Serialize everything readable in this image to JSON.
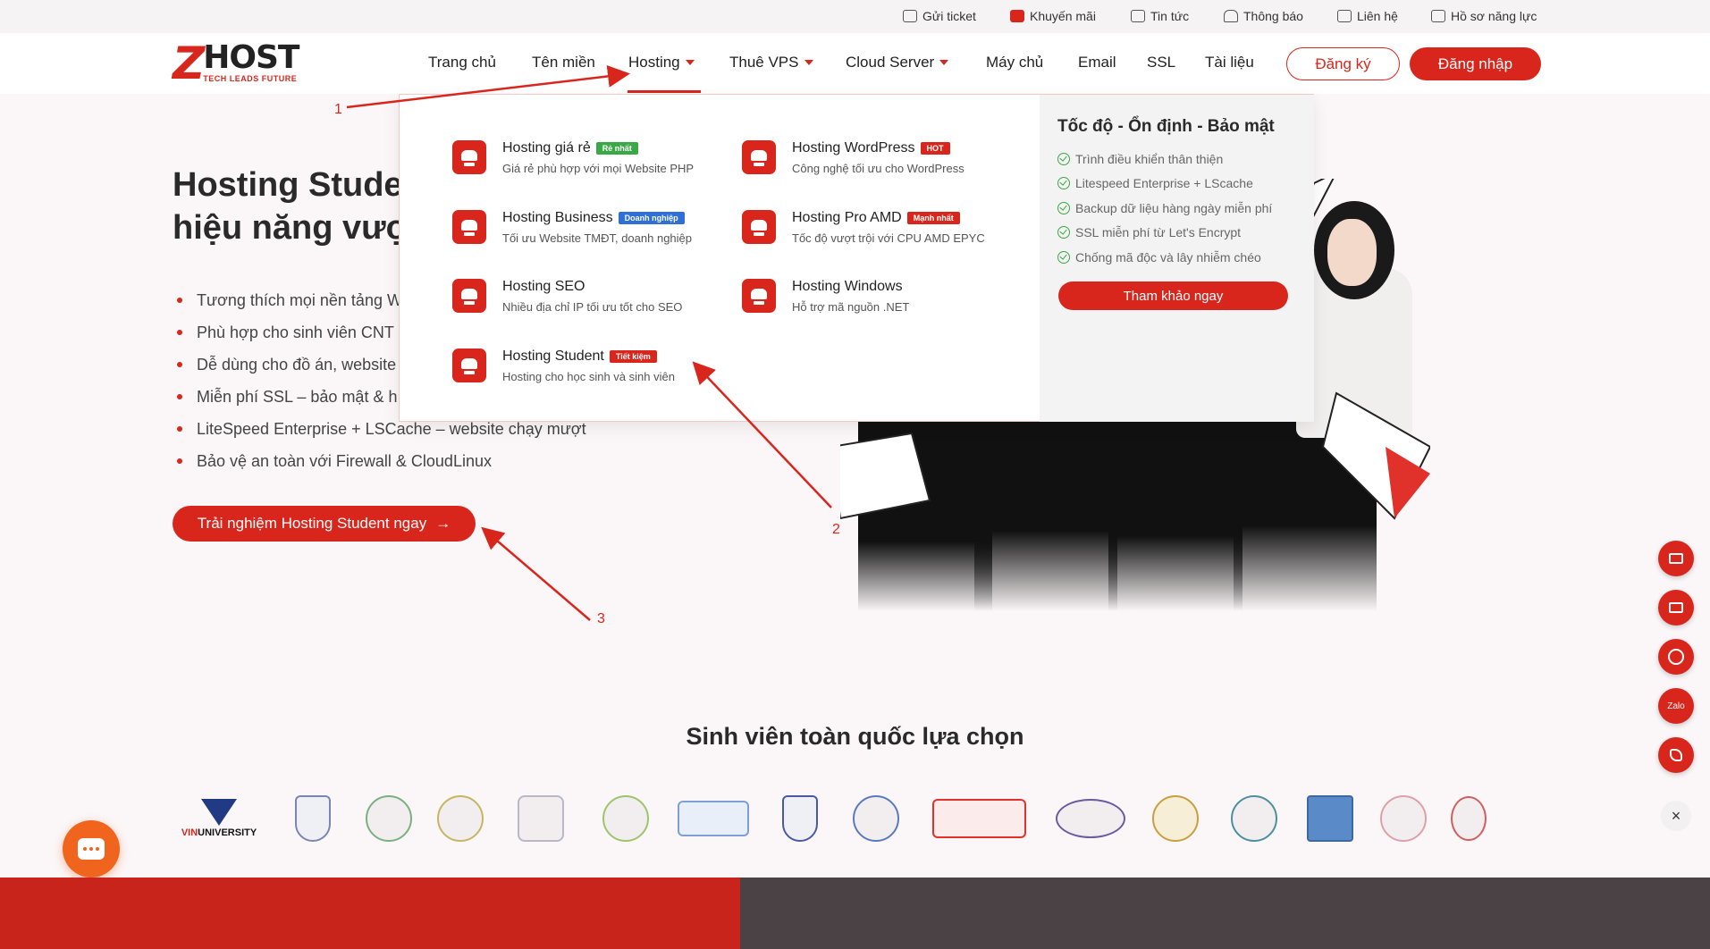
{
  "topbar": {
    "items": [
      {
        "label": "Gửi ticket",
        "icon": "ticket-icon"
      },
      {
        "label": "Khuyến mãi",
        "icon": "gift-icon"
      },
      {
        "label": "Tin tức",
        "icon": "news-icon"
      },
      {
        "label": "Thông báo",
        "icon": "bell-icon"
      },
      {
        "label": "Liên hệ",
        "icon": "chat-icon"
      },
      {
        "label": "Hồ sơ năng lực",
        "icon": "folder-icon"
      }
    ]
  },
  "brand": {
    "name": "HOST",
    "tagline": "TECH LEADS FUTURE",
    "accent": "#d9261c"
  },
  "nav": {
    "items": [
      "Trang chủ",
      "Tên miền",
      "Hosting",
      "Thuê VPS",
      "Cloud Server",
      "Máy chủ",
      "Email",
      "SSL",
      "Tài liệu"
    ],
    "register": "Đăng ký",
    "login": "Đăng nhập"
  },
  "hero": {
    "title_line1": "Hosting Stude",
    "title_line2": "hiệu năng vượ",
    "bullets": [
      "Tương thích mọi nền tảng W",
      "Phù hợp cho sinh viên CNT",
      "Dễ dùng cho đồ án, website",
      "Miễn phí SSL – bảo mật & h",
      "LiteSpeed Enterprise + LSCache – website chạy mượt",
      "Bảo vệ an toàn với Firewall & CloudLinux"
    ],
    "cta": "Trải nghiệm Hosting Student ngay",
    "cta_arrow": "→"
  },
  "mega_menu": {
    "items": [
      {
        "title": "Hosting giá rẻ",
        "badge": "Rẻ nhất",
        "badge_color": "#3aa845",
        "desc": "Giá rẻ phù hợp với mọi Website PHP"
      },
      {
        "title": "Hosting WordPress",
        "badge": "HOT",
        "badge_color": "#d9261c",
        "desc": "Công nghệ tối ưu cho WordPress"
      },
      {
        "title": "Hosting Business",
        "badge": "Doanh nghiệp",
        "badge_color": "#2f6fd6",
        "desc": "Tối ưu Website TMĐT, doanh nghiệp"
      },
      {
        "title": "Hosting Pro AMD",
        "badge": "Mạnh nhất",
        "badge_color": "#d9261c",
        "desc": "Tốc độ vượt trội với CPU AMD EPYC"
      },
      {
        "title": "Hosting SEO",
        "badge": "",
        "badge_color": "",
        "desc": "Nhiều địa chỉ IP tối ưu tốt cho SEO"
      },
      {
        "title": "Hosting Windows",
        "badge": "",
        "badge_color": "",
        "desc": "Hỗ trợ mã nguồn .NET"
      },
      {
        "title": "Hosting Student",
        "badge": "Tiết kiệm",
        "badge_color": "#d9261c",
        "desc": "Hosting cho học sinh và sinh viên"
      }
    ],
    "side": {
      "title": "Tốc độ - Ổn định - Bảo mật",
      "features": [
        "Trình điều khiển thân thiện",
        "Litespeed Enterprise + LScache",
        "Backup dữ liệu hàng ngày miễn phí",
        "SSL miễn phí từ Let's Encrypt",
        "Chống mã độc và lây nhiễm chéo"
      ],
      "button": "Tham khảo ngay"
    }
  },
  "annotations": [
    "1",
    "2",
    "3"
  ],
  "section": {
    "title": "Sinh viên toàn quốc lựa chọn"
  },
  "universities": {
    "first": {
      "prefix": "VIN",
      "rest": "UNIVERSITY"
    }
  },
  "floating": {
    "zalo": "Zalo",
    "close": "×"
  }
}
